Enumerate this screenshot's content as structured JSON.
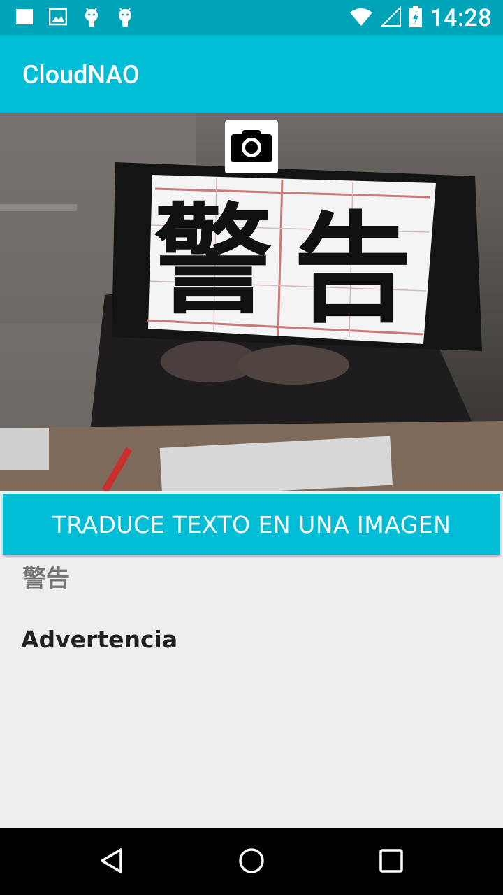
{
  "status_bar": {
    "time": "14:28",
    "left_icons": [
      "stop-square-icon",
      "image-icon",
      "android-icon",
      "android-icon"
    ],
    "right_icons": [
      "wifi-icon",
      "signal-icon",
      "battery-icon"
    ]
  },
  "app_bar": {
    "title": "CloudNAO"
  },
  "camera": {
    "capture_icon": "camera-icon",
    "preview_description": "Photo of a phone screen showing Chinese characters 警告"
  },
  "main": {
    "translate_button_label": "TRADUCE TEXTO EN UNA IMAGEN",
    "detected_text": "警告",
    "translated_text": "Advertencia"
  },
  "nav_bar": {
    "icons": [
      "back-icon",
      "home-icon",
      "recents-icon"
    ]
  },
  "colors": {
    "status_bar": "#00a4b8",
    "app_bar": "#00bcd4",
    "button": "#00bcd4",
    "background": "#eeeeee"
  }
}
